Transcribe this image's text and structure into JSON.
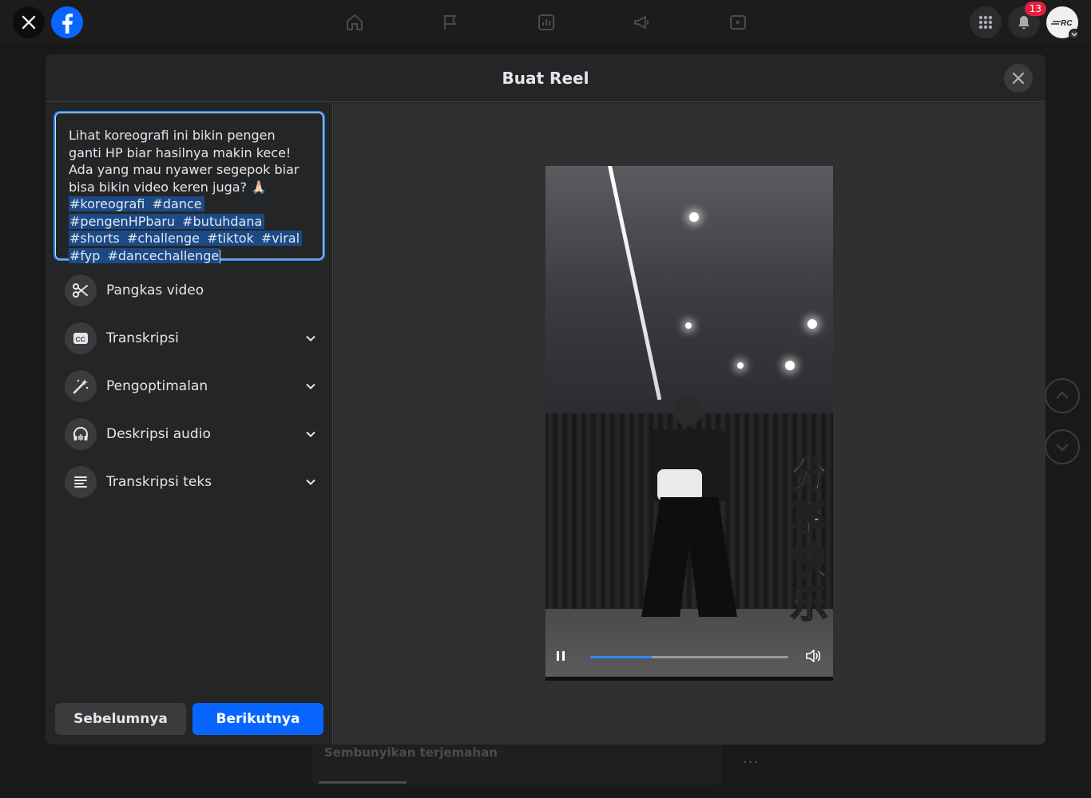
{
  "topbar": {
    "notifications_count": "13",
    "nav_icons": [
      "home-icon",
      "flag-icon",
      "stats-icon",
      "megaphone-icon",
      "video-icon"
    ]
  },
  "background": {
    "hide_translation": "Sembunyikan terjemahan",
    "more": "..."
  },
  "modal": {
    "title": "Buat Reel",
    "caption": {
      "text": "Lihat koreografi ini bikin pengen ganti HP biar hasilnya makin kece! Ada yang mau nyawer segepok biar bisa bikin video keren juga? 🙏🏻",
      "hashtags": [
        "#koreografi",
        "#dance",
        "#pengenHPbaru",
        "#butuhdana",
        "#shorts",
        "#challenge",
        "#tiktok",
        "#viral",
        "#fyp",
        "#dancechallenge"
      ]
    },
    "menu": [
      {
        "label": "Pangkas video",
        "icon": "scissors-icon",
        "expandable": false
      },
      {
        "label": "Transkripsi",
        "icon": "closed-captions-icon",
        "expandable": true
      },
      {
        "label": "Pengoptimalan",
        "icon": "magic-wand-icon",
        "expandable": true
      },
      {
        "label": "Deskripsi audio",
        "icon": "headphones-icon",
        "expandable": true
      },
      {
        "label": "Transkripsi teks",
        "icon": "text-lines-icon",
        "expandable": true
      }
    ],
    "buttons": {
      "previous": "Sebelumnya",
      "next": "Berikutnya"
    },
    "video": {
      "overlay_text": "分享快乐",
      "progress": 0.31
    }
  },
  "colors": {
    "accent": "#0866ff",
    "focus_border": "#2d88ff",
    "hashtag_highlight": "#1b4a87",
    "badge": "#e41e3f"
  }
}
